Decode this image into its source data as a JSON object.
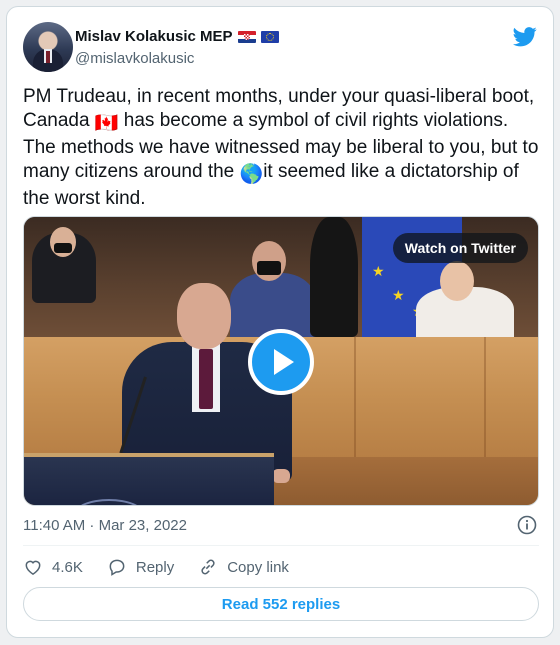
{
  "author": {
    "name": "Mislav Kolakusic MEP",
    "handle": "@mislavkolakusic",
    "flags": [
      "croatia-flag",
      "eu-flag"
    ]
  },
  "tweet": {
    "part1": "PM Trudeau, in recent months, under your quasi-liberal boot, Canada ",
    "part2": " has become a symbol of civil rights violations. The methods we have witnessed may be liberal to you, but to many citizens around the ",
    "part3": "it seemed like a dictatorship of the worst kind.",
    "emoji1": "🇨🇦",
    "emoji2": "🌎"
  },
  "media": {
    "watch_label": "Watch on Twitter"
  },
  "meta": {
    "timestamp": "11:40 AM · Mar 23, 2022"
  },
  "actions": {
    "likes": "4.6K",
    "reply_label": "Reply",
    "copy_label": "Copy link"
  },
  "footer": {
    "replies_label": "Read 552 replies"
  },
  "colors": {
    "accent": "#1d9bf0",
    "secondary_text": "#536471",
    "border": "#cfd9de"
  },
  "icons": [
    "twitter-bird-icon",
    "play-icon",
    "info-icon",
    "heart-icon",
    "reply-icon",
    "link-icon"
  ]
}
